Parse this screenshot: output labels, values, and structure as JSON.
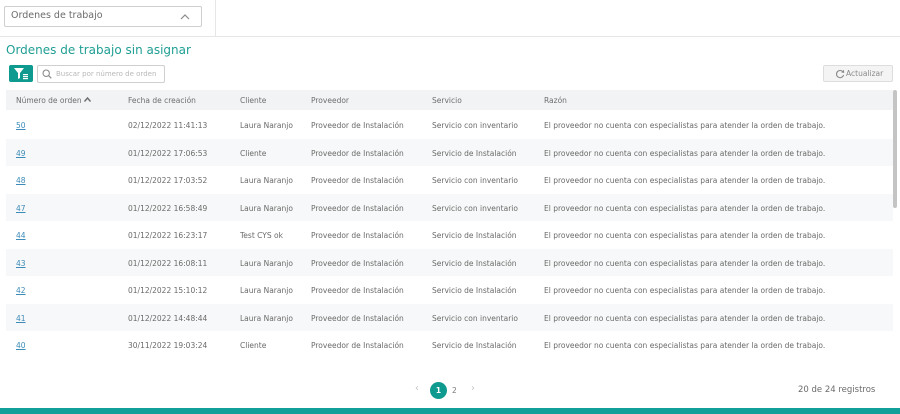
{
  "filter": {
    "select_value": "Ordenes de trabajo"
  },
  "section_title": "Ordenes de trabajo sin asignar",
  "search": {
    "placeholder": "Buscar por número de orden"
  },
  "refresh_label": "Actualizar",
  "columns": [
    "Número de orden",
    "Fecha de creación",
    "Cliente",
    "Proveedor",
    "Servicio",
    "Razón"
  ],
  "rows": [
    {
      "order": "50",
      "date": "02/12/2022 11:41:13",
      "client": "Laura Naranjo",
      "provider": "Proveedor de Instalación",
      "service": "Servicio con inventario",
      "reason": "El proveedor no cuenta con especialistas para atender la orden de trabajo."
    },
    {
      "order": "49",
      "date": "01/12/2022 17:06:53",
      "client": "Cliente",
      "provider": "Proveedor de Instalación",
      "service": "Servicio de Instalación",
      "reason": "El proveedor no cuenta con especialistas para atender la orden de trabajo."
    },
    {
      "order": "48",
      "date": "01/12/2022 17:03:52",
      "client": "Laura Naranjo",
      "provider": "Proveedor de Instalación",
      "service": "Servicio con inventario",
      "reason": "El proveedor no cuenta con especialistas para atender la orden de trabajo."
    },
    {
      "order": "47",
      "date": "01/12/2022 16:58:49",
      "client": "Laura Naranjo",
      "provider": "Proveedor de Instalación",
      "service": "Servicio con inventario",
      "reason": "El proveedor no cuenta con especialistas para atender la orden de trabajo."
    },
    {
      "order": "44",
      "date": "01/12/2022 16:23:17",
      "client": "Test CYS ok",
      "provider": "Proveedor de Instalación",
      "service": "Servicio de Instalación",
      "reason": "El proveedor no cuenta con especialistas para atender la orden de trabajo."
    },
    {
      "order": "43",
      "date": "01/12/2022 16:08:11",
      "client": "Laura Naranjo",
      "provider": "Proveedor de Instalación",
      "service": "Servicio de Instalación",
      "reason": "El proveedor no cuenta con especialistas para atender la orden de trabajo."
    },
    {
      "order": "42",
      "date": "01/12/2022 15:10:12",
      "client": "Laura Naranjo",
      "provider": "Proveedor de Instalación",
      "service": "Servicio de Instalación",
      "reason": "El proveedor no cuenta con especialistas para atender la orden de trabajo."
    },
    {
      "order": "41",
      "date": "01/12/2022 14:48:44",
      "client": "Laura Naranjo",
      "provider": "Proveedor de Instalación",
      "service": "Servicio con inventario",
      "reason": "El proveedor no cuenta con especialistas para atender la orden de trabajo."
    },
    {
      "order": "40",
      "date": "30/11/2022 19:03:24",
      "client": "Cliente",
      "provider": "Proveedor de Instalación",
      "service": "Servicio de Instalación",
      "reason": "El proveedor no cuenta con especialistas para atender la orden de trabajo."
    }
  ],
  "pagination": {
    "pages": [
      "1",
      "2"
    ],
    "current": "1",
    "records": "20 de 24 registros"
  },
  "colors": {
    "accent": "#0f9a8f",
    "title": "#1f9e94",
    "link": "#3d8bb8"
  },
  "icons": {
    "select": "chevron-up-icon",
    "filter": "filter-icon",
    "search": "search-icon",
    "refresh": "refresh-icon",
    "sort": "chevron-up-icon",
    "prev": "chevron-left-icon",
    "next": "chevron-right-icon"
  }
}
